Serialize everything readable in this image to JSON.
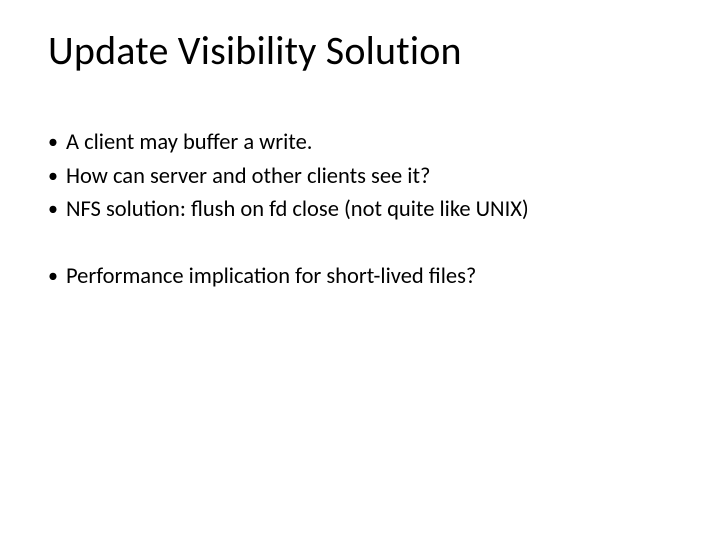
{
  "slide": {
    "title": "Update Visibility Solution",
    "groups": [
      {
        "items": [
          "A client may buffer a write.",
          "How can server and other clients see it?",
          "NFS solution: flush on fd close (not quite like UNIX)"
        ]
      },
      {
        "items": [
          "Performance implication for short-lived files?"
        ]
      }
    ]
  },
  "bullet_char": "•"
}
